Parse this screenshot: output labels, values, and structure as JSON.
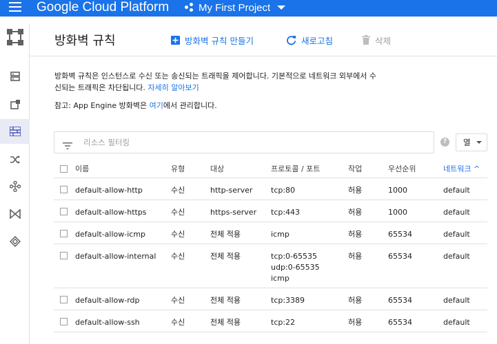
{
  "topbar": {
    "brand": "Google Cloud Platform",
    "project": "My First Project"
  },
  "nav": {
    "items": [
      {
        "icon": "instance-list-icon"
      },
      {
        "icon": "external-link-icon"
      },
      {
        "icon": "firewall-icon",
        "active": true
      },
      {
        "icon": "routes-icon"
      },
      {
        "icon": "network-peering-icon"
      },
      {
        "icon": "interconnect-icon"
      },
      {
        "icon": "shared-vpc-icon"
      }
    ]
  },
  "header": {
    "title": "방화벽 규칙",
    "create_label": "방화벽 규칙 만들기",
    "refresh_label": "새로고침",
    "delete_label": "삭제"
  },
  "desc": {
    "text": "방화벽 규칙은 인스턴스로 수신 또는 송신되는 트래픽을 제어합니다. 기본적으로 네트워크 외부에서 수신되는 트래픽은 차단됩니다.",
    "link": "자세히 알아보기"
  },
  "note": {
    "before": "참고: App Engine 방화벽은 ",
    "link": "여기",
    "after": "에서 관리합니다."
  },
  "filter": {
    "placeholder": "리소스 필터링"
  },
  "columns_button": "열",
  "table": {
    "headers": {
      "name": "이름",
      "type": "유형",
      "target": "대상",
      "protocol": "프로토콜 / 포트",
      "action": "작업",
      "priority": "우선순위",
      "network": "네트워크"
    },
    "sort_column": "network",
    "rows": [
      {
        "name": "default-allow-http",
        "type": "수신",
        "target": "http-server",
        "protocol": [
          "tcp:80"
        ],
        "action": "허용",
        "priority": "1000",
        "network": "default"
      },
      {
        "name": "default-allow-https",
        "type": "수신",
        "target": "https-server",
        "protocol": [
          "tcp:443"
        ],
        "action": "허용",
        "priority": "1000",
        "network": "default"
      },
      {
        "name": "default-allow-icmp",
        "type": "수신",
        "target": "전체 적용",
        "protocol": [
          "icmp"
        ],
        "action": "허용",
        "priority": "65534",
        "network": "default"
      },
      {
        "name": "default-allow-internal",
        "type": "수신",
        "target": "전체 적용",
        "protocol": [
          "tcp:0-65535",
          "udp:0-65535",
          "icmp"
        ],
        "action": "허용",
        "priority": "65534",
        "network": "default"
      },
      {
        "name": "default-allow-rdp",
        "type": "수신",
        "target": "전체 적용",
        "protocol": [
          "tcp:3389"
        ],
        "action": "허용",
        "priority": "65534",
        "network": "default"
      },
      {
        "name": "default-allow-ssh",
        "type": "수신",
        "target": "전체 적용",
        "protocol": [
          "tcp:22"
        ],
        "action": "허용",
        "priority": "65534",
        "network": "default"
      }
    ]
  },
  "colors": {
    "appbar": "#1a73e8",
    "accent": "#1a73e8",
    "rail_active": "#e8eaf6"
  }
}
